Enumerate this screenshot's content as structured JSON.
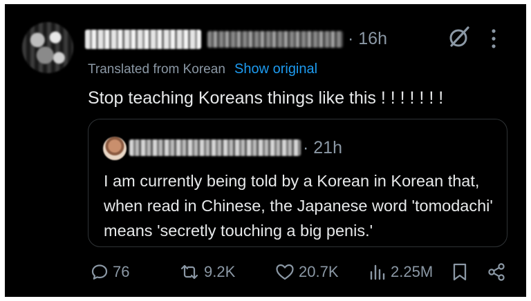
{
  "post": {
    "time": "· 16h",
    "translated_label": "Translated from Korean",
    "show_original_label": "Show original",
    "text": "Stop teaching Koreans things like this ! ! ! ! ! ! !"
  },
  "quoted_post": {
    "time": "· 21h",
    "text": "I am currently being told by a Korean in Korean that, when read in Chinese, the Japanese word 'tomodachi' means 'secretly touching a big penis.'"
  },
  "actions": {
    "replies": "76",
    "reposts": "9.2K",
    "likes": "20.7K",
    "views": "2.25M"
  },
  "icons": {
    "header": [
      "grok-icon",
      "more-icon"
    ],
    "action_bar": [
      "reply-icon",
      "repost-icon",
      "like-icon",
      "views-icon",
      "bookmark-icon",
      "share-icon"
    ]
  },
  "colors": {
    "background": "#000000",
    "text": "#e7e9ea",
    "secondary_text": "#8b98a5",
    "link": "#1d9bf0",
    "border": "#2f3336"
  }
}
